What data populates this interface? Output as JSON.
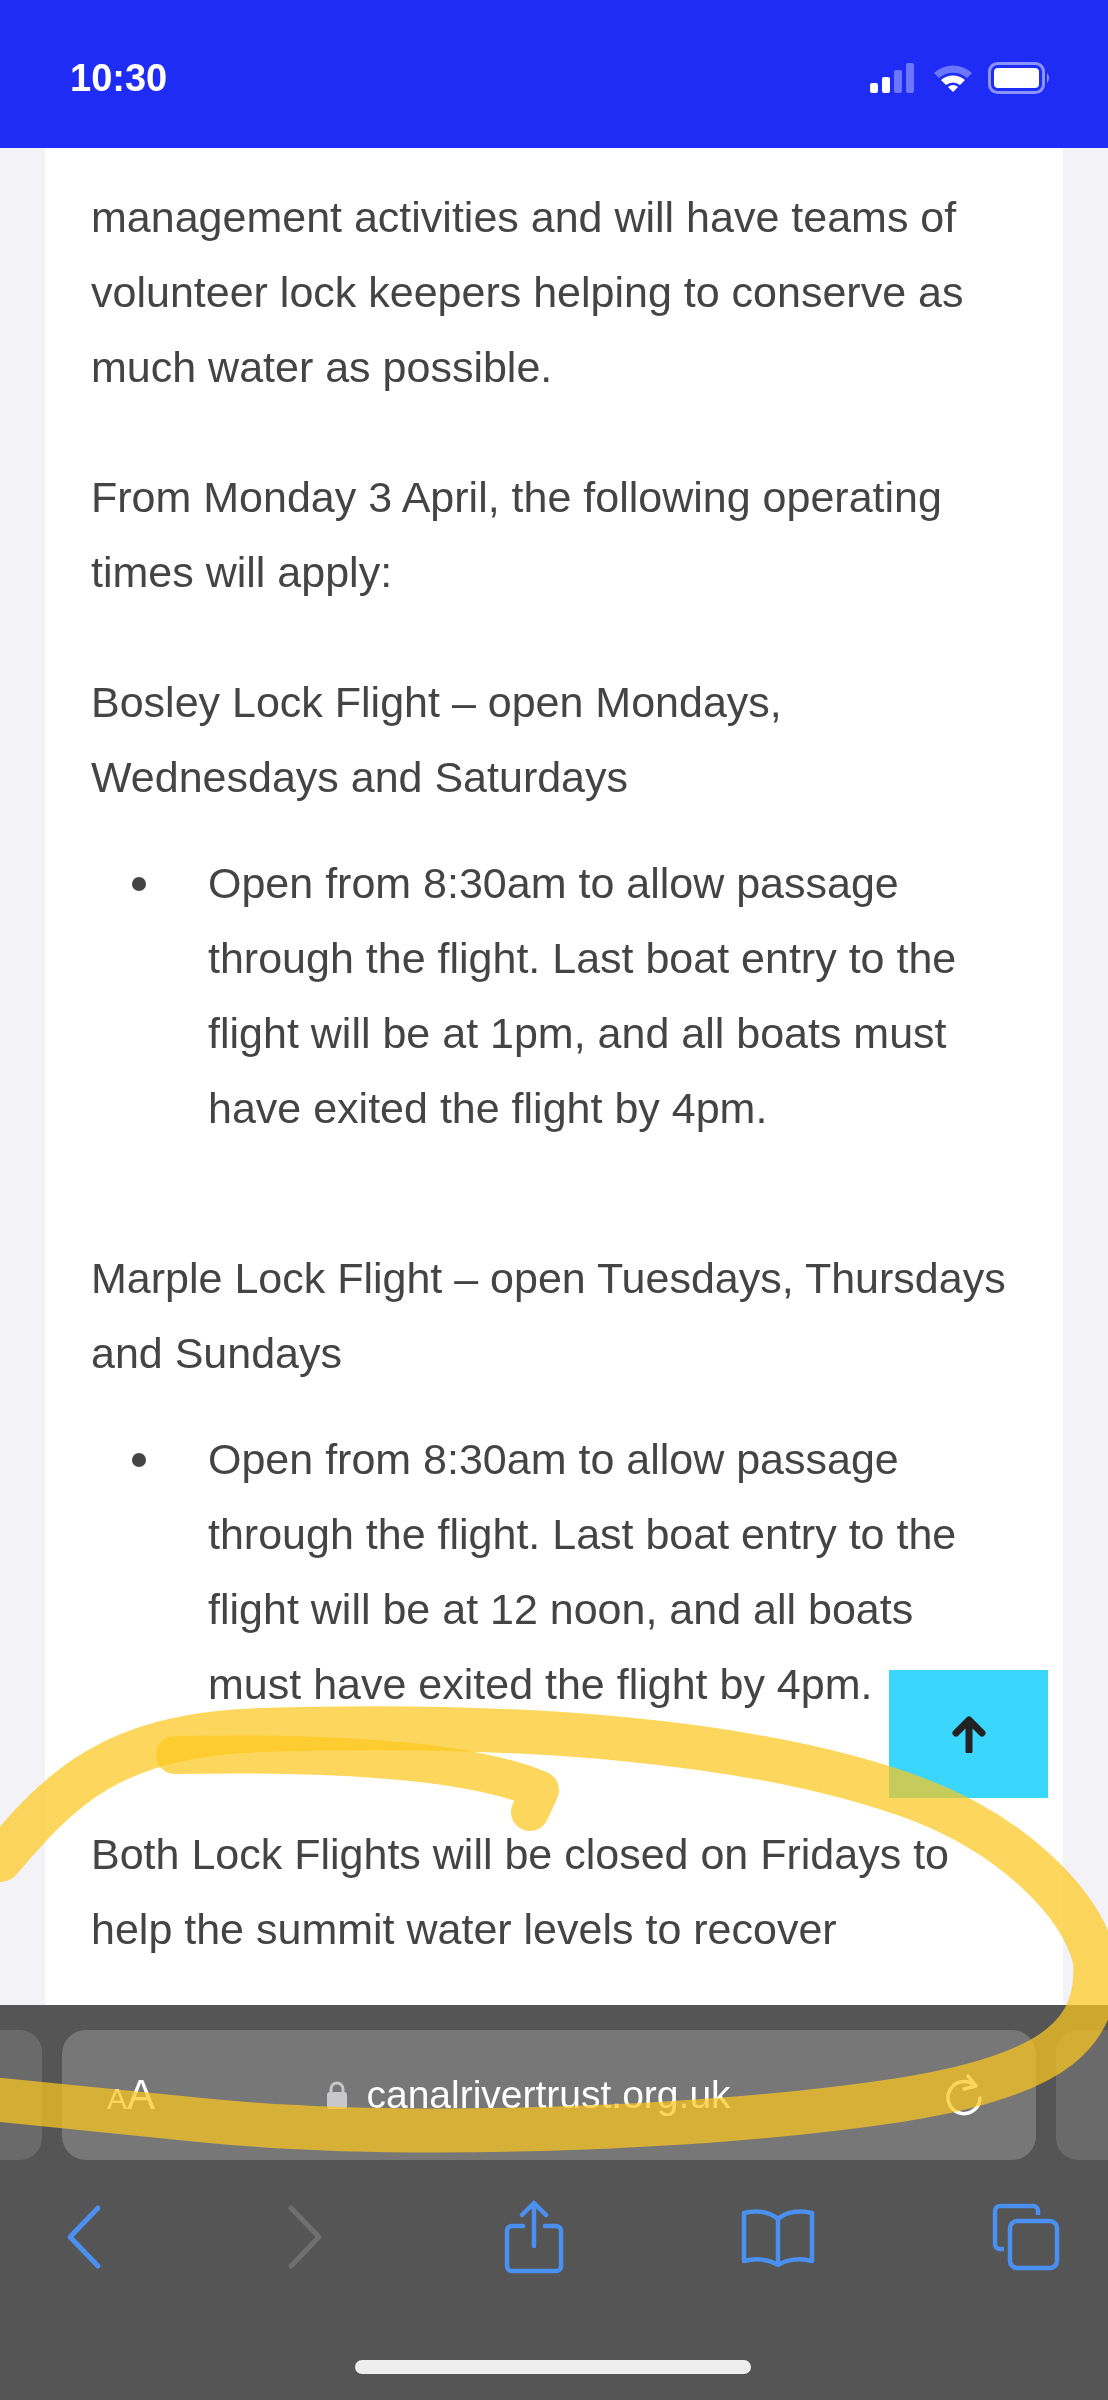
{
  "status_bar": {
    "time": "10:30"
  },
  "article": {
    "blocks": [
      {
        "kind": "paragraph",
        "text": "management activities and will have teams of volunteer lock keepers helping to conserve as much water as possible."
      },
      {
        "kind": "paragraph",
        "text": "From Monday 3 April, the following operating times will apply:"
      },
      {
        "kind": "paragraph",
        "text": "Bosley Lock Flight – open Mondays, Wednesdays and Saturdays"
      },
      {
        "kind": "list",
        "items": [
          "Open from 8:30am to allow passage through the flight. Last boat entry to the flight will be at 1pm, and all boats must have exited the flight by 4pm."
        ]
      },
      {
        "kind": "paragraph",
        "text": "Marple Lock Flight – open Tuesdays, Thursdays and Sundays"
      },
      {
        "kind": "list",
        "items": [
          "Open from 8:30am to allow passage through the flight. Last boat entry to the flight will be at 12 noon, and all boats must have exited the flight by 4pm."
        ]
      },
      {
        "kind": "paragraph",
        "text": "Both Lock Flights will be closed on Fridays to help the summit water levels to recover"
      }
    ]
  },
  "browser": {
    "text_size_button": "AA",
    "url": "canalrivertrust.org.uk",
    "toolbar": [
      {
        "kind": "back",
        "disabled": false
      },
      {
        "kind": "forward",
        "disabled": true
      },
      {
        "kind": "share"
      },
      {
        "kind": "bookmarks"
      },
      {
        "kind": "tabs"
      }
    ]
  }
}
